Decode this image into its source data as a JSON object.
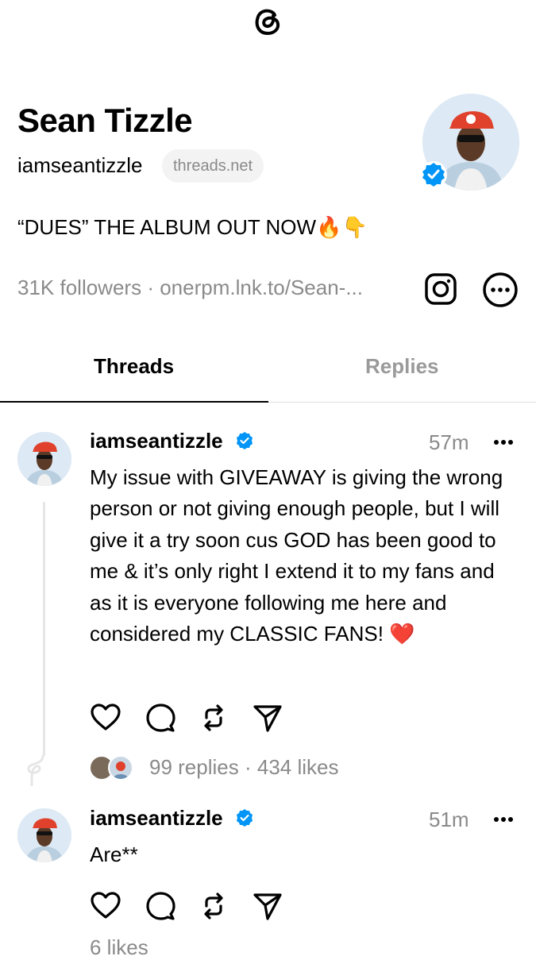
{
  "app": {
    "logo_icon": "threads-logo-icon"
  },
  "profile": {
    "name": "Sean Tizzle",
    "handle": "iamseantizzle",
    "domain_pill": "threads.net",
    "bio": "“DUES” THE ALBUM OUT NOW🔥👇",
    "followers": "31K followers",
    "link": "onerpm.lnk.to/Sean-...",
    "verified": true,
    "icons": {
      "instagram": "instagram-icon",
      "more": "more-options-icon"
    }
  },
  "tabs": [
    {
      "label": "Threads",
      "active": true
    },
    {
      "label": "Replies",
      "active": false
    }
  ],
  "posts": [
    {
      "user": "iamseantizzle",
      "time": "57m",
      "text": "My issue with GIVEAWAY is giving the wrong person or not giving enough people, but I will give it a try soon cus GOD has been good to me & it’s only right I extend it to my fans and as it is everyone following me here and considered my CLASSIC FANS! ❤️",
      "replies": "99 replies",
      "likes": "434 likes"
    },
    {
      "user": "iamseantizzle",
      "time": "51m",
      "text": "Are**",
      "likes": "6 likes"
    }
  ],
  "colors": {
    "verified": "#0095f6",
    "muted": "#8a8a8a",
    "text": "#000000"
  }
}
